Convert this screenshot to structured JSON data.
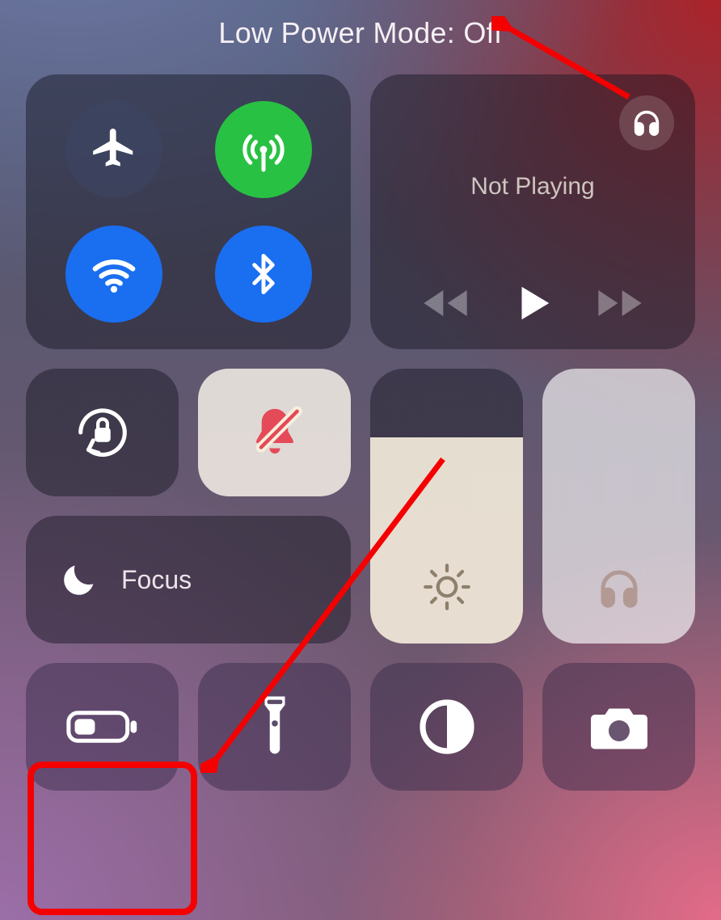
{
  "status": {
    "title": "Low Power Mode: Off"
  },
  "media": {
    "status_text": "Not Playing"
  },
  "focus": {
    "label": "Focus"
  },
  "brightness": {
    "level_percent": 75
  },
  "volume": {
    "level_percent": 100
  },
  "colors": {
    "active_blue": "#1a6ef0",
    "active_green": "#29c143",
    "annotation_red": "#f40000",
    "bell_red": "#e54a58"
  }
}
